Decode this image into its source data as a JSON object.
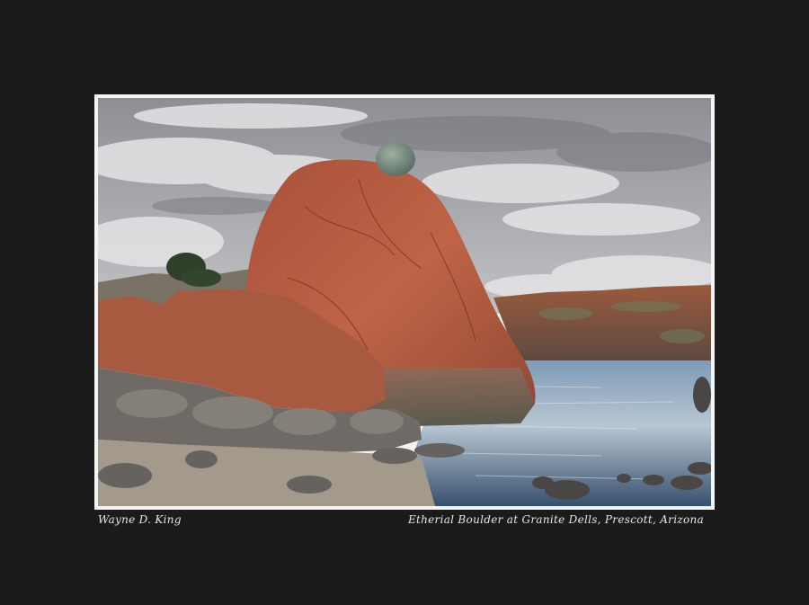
{
  "photo": {
    "photographer": "Wayne D. King",
    "title": "Etherial Boulder at Granite Dells, Prescott, Arizona"
  },
  "colors": {
    "background": "#1b1b1c",
    "frame": "#f4f4f4",
    "sky": "#a8a9ad",
    "granite": "#b4573a",
    "water": "#5d7c9e"
  }
}
